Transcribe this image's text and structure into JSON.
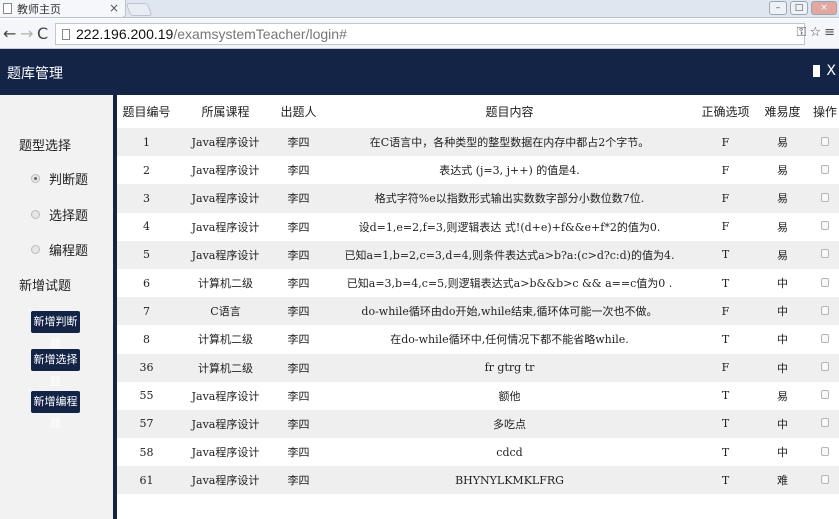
{
  "browser": {
    "tab_title": "教师主页",
    "tab_close": "×",
    "url_host": "222.196.200.19",
    "url_path": "/examsystemTeacher/login#",
    "back": "←",
    "forward": "→",
    "reload": "C",
    "win_min": "–",
    "win_max": "□",
    "win_close": "×"
  },
  "header": {
    "title": "题库管理",
    "close": "X"
  },
  "sidebar": {
    "type_label": "题型选择",
    "types": [
      {
        "label": "判断题",
        "selected": true
      },
      {
        "label": "选择题",
        "selected": false
      },
      {
        "label": "编程题",
        "selected": false
      }
    ],
    "new_label": "新增试题",
    "buttons": [
      "新增判断题",
      "新增选择题",
      "新增编程题"
    ]
  },
  "table": {
    "columns": [
      "题目编号",
      "所属课程",
      "出题人",
      "题目内容",
      "正确选项",
      "难易度",
      "操作"
    ],
    "rows": [
      {
        "id": "1",
        "course": "Java程序设计",
        "author": "李四",
        "content": "在C语言中，各种类型的整型数据在内存中都占2个字节。",
        "answer": "F",
        "difficulty": "易"
      },
      {
        "id": "2",
        "course": "Java程序设计",
        "author": "李四",
        "content": "表达式 (j=3, j++) 的值是4.",
        "answer": "F",
        "difficulty": "易"
      },
      {
        "id": "3",
        "course": "Java程序设计",
        "author": "李四",
        "content": "格式字符%e以指数形式输出实数数字部分小数位数7位.",
        "answer": "F",
        "difficulty": "易"
      },
      {
        "id": "4",
        "course": "Java程序设计",
        "author": "李四",
        "content": "设d=1,e=2,f=3,则逻辑表达 式!(d+e)+f&&e+f*2的值为0.",
        "answer": "F",
        "difficulty": "易"
      },
      {
        "id": "5",
        "course": "Java程序设计",
        "author": "李四",
        "content": "已知a=1,b=2,c=3,d=4,则条件表达式a>b?a:(c>d?c:d)的值为4.",
        "answer": "T",
        "difficulty": "易"
      },
      {
        "id": "6",
        "course": "计算机二级",
        "author": "李四",
        "content": "已知a=3,b=4,c=5,则逻辑表达式a>b&&b>c && a==c值为0 .",
        "answer": "T",
        "difficulty": "中"
      },
      {
        "id": "7",
        "course": "C语言",
        "author": "李四",
        "content": "do-while循环由do开始,while结束,循环体可能一次也不做。",
        "answer": "F",
        "difficulty": "中"
      },
      {
        "id": "8",
        "course": "计算机二级",
        "author": "李四",
        "content": "在do-while循环中,任何情况下都不能省略while.",
        "answer": "T",
        "difficulty": "中"
      },
      {
        "id": "36",
        "course": "计算机二级",
        "author": "李四",
        "content": "fr gtrg tr",
        "answer": "F",
        "difficulty": "中"
      },
      {
        "id": "55",
        "course": "Java程序设计",
        "author": "李四",
        "content": "额他",
        "answer": "T",
        "difficulty": "易"
      },
      {
        "id": "57",
        "course": "Java程序设计",
        "author": "李四",
        "content": "多吃点",
        "answer": "T",
        "difficulty": "中"
      },
      {
        "id": "58",
        "course": "Java程序设计",
        "author": "李四",
        "content": "cdcd",
        "answer": "T",
        "difficulty": "中"
      },
      {
        "id": "61",
        "course": "Java程序设计",
        "author": "李四",
        "content": "BHYNYLKMKLFRG",
        "answer": "T",
        "difficulty": "难"
      }
    ]
  }
}
